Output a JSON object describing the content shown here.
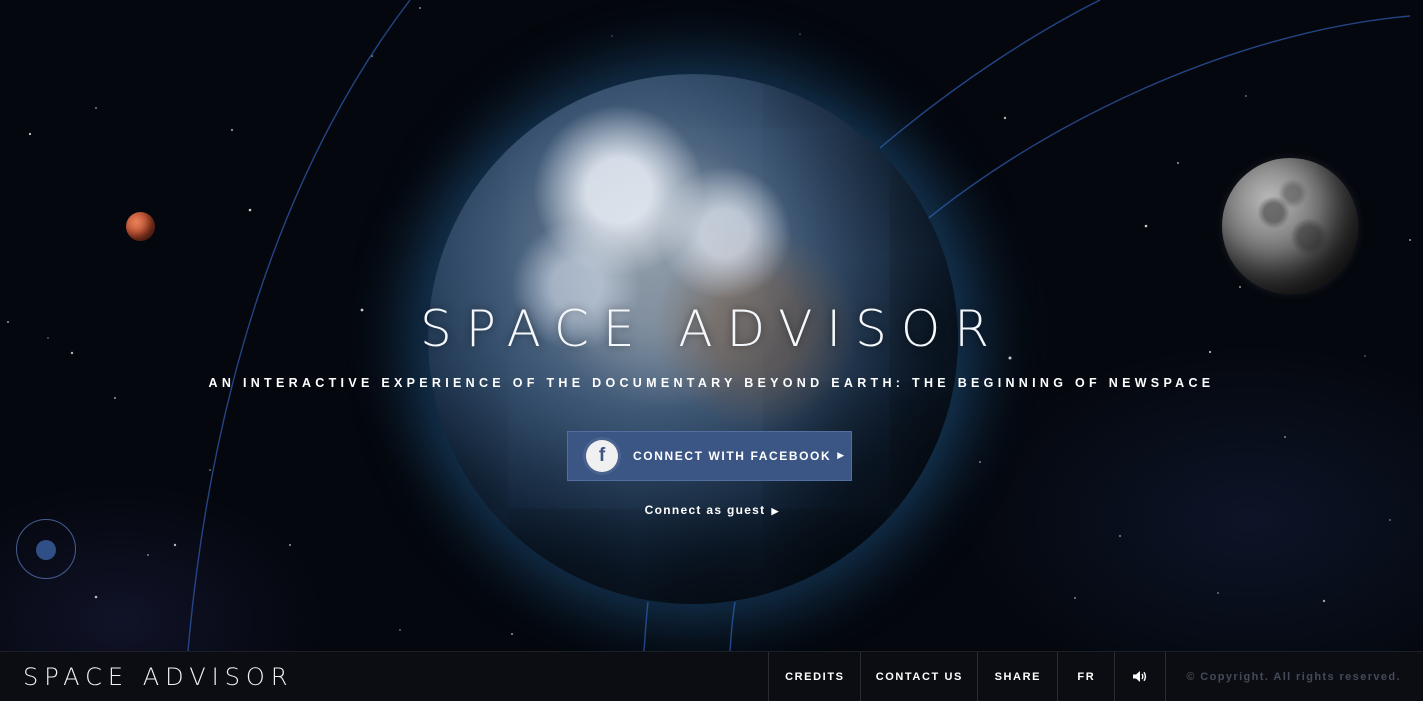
{
  "hero": {
    "title": "SPACE ADVISOR",
    "tagline": "AN INTERACTIVE EXPERIENCE OF THE DOCUMENTARY BEYOND EARTH: THE BEGINNING OF NEWSPACE",
    "facebook_button": {
      "icon_letter": "f",
      "label": "CONNECT WITH FACEBOOK",
      "arrow": "▶"
    },
    "guest_link": {
      "label": "Connect as guest",
      "arrow": "▶"
    }
  },
  "footer": {
    "logo": "SPACE ADVISOR",
    "nav": [
      {
        "label": "CREDITS"
      },
      {
        "label": "CONTACT US"
      },
      {
        "label": "SHARE"
      },
      {
        "label": "FR"
      }
    ],
    "sound_icon": "speaker-volume-icon",
    "copyright": "© Copyright. All rights reserved."
  },
  "colors": {
    "background": "#04070d",
    "facebook_blue": "#3b5585",
    "footer_bg": "#0b0d12",
    "orbit_line": "#2a4f9a",
    "copyright_text": "#444a58"
  },
  "icons": {
    "facebook": "facebook-icon",
    "orbit_navigator": "orbit-navigator-icon"
  }
}
